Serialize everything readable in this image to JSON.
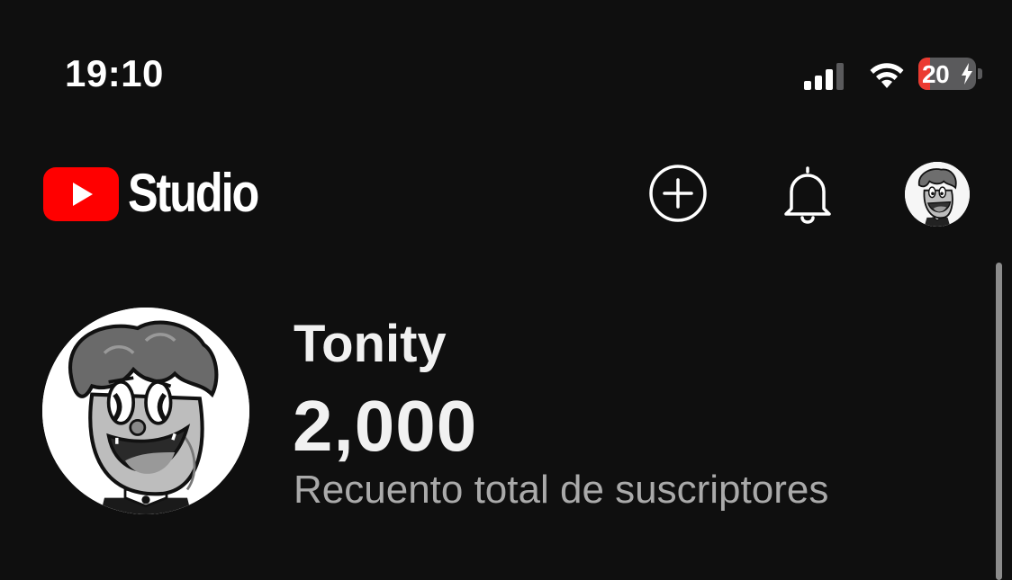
{
  "status_bar": {
    "time": "19:10",
    "battery_level": "20",
    "battery_charging": true,
    "signal_icon": "cellular-signal-icon",
    "wifi_icon": "wifi-icon"
  },
  "header": {
    "brand": "Studio",
    "logo_icon": "youtube-play-logo",
    "logo_color": "#ff0000",
    "actions": {
      "create_icon": "plus-circle-icon",
      "notifications_icon": "bell-icon",
      "account_icon": "avatar"
    }
  },
  "channel": {
    "name": "Tonity",
    "subscriber_count": "2,000",
    "subscriber_label": "Recuento total de suscriptores"
  },
  "colors": {
    "background": "#0f0f0f",
    "text_primary": "#f1f1f1",
    "text_secondary": "#aaaaaa",
    "battery_low": "#eb3b31"
  }
}
